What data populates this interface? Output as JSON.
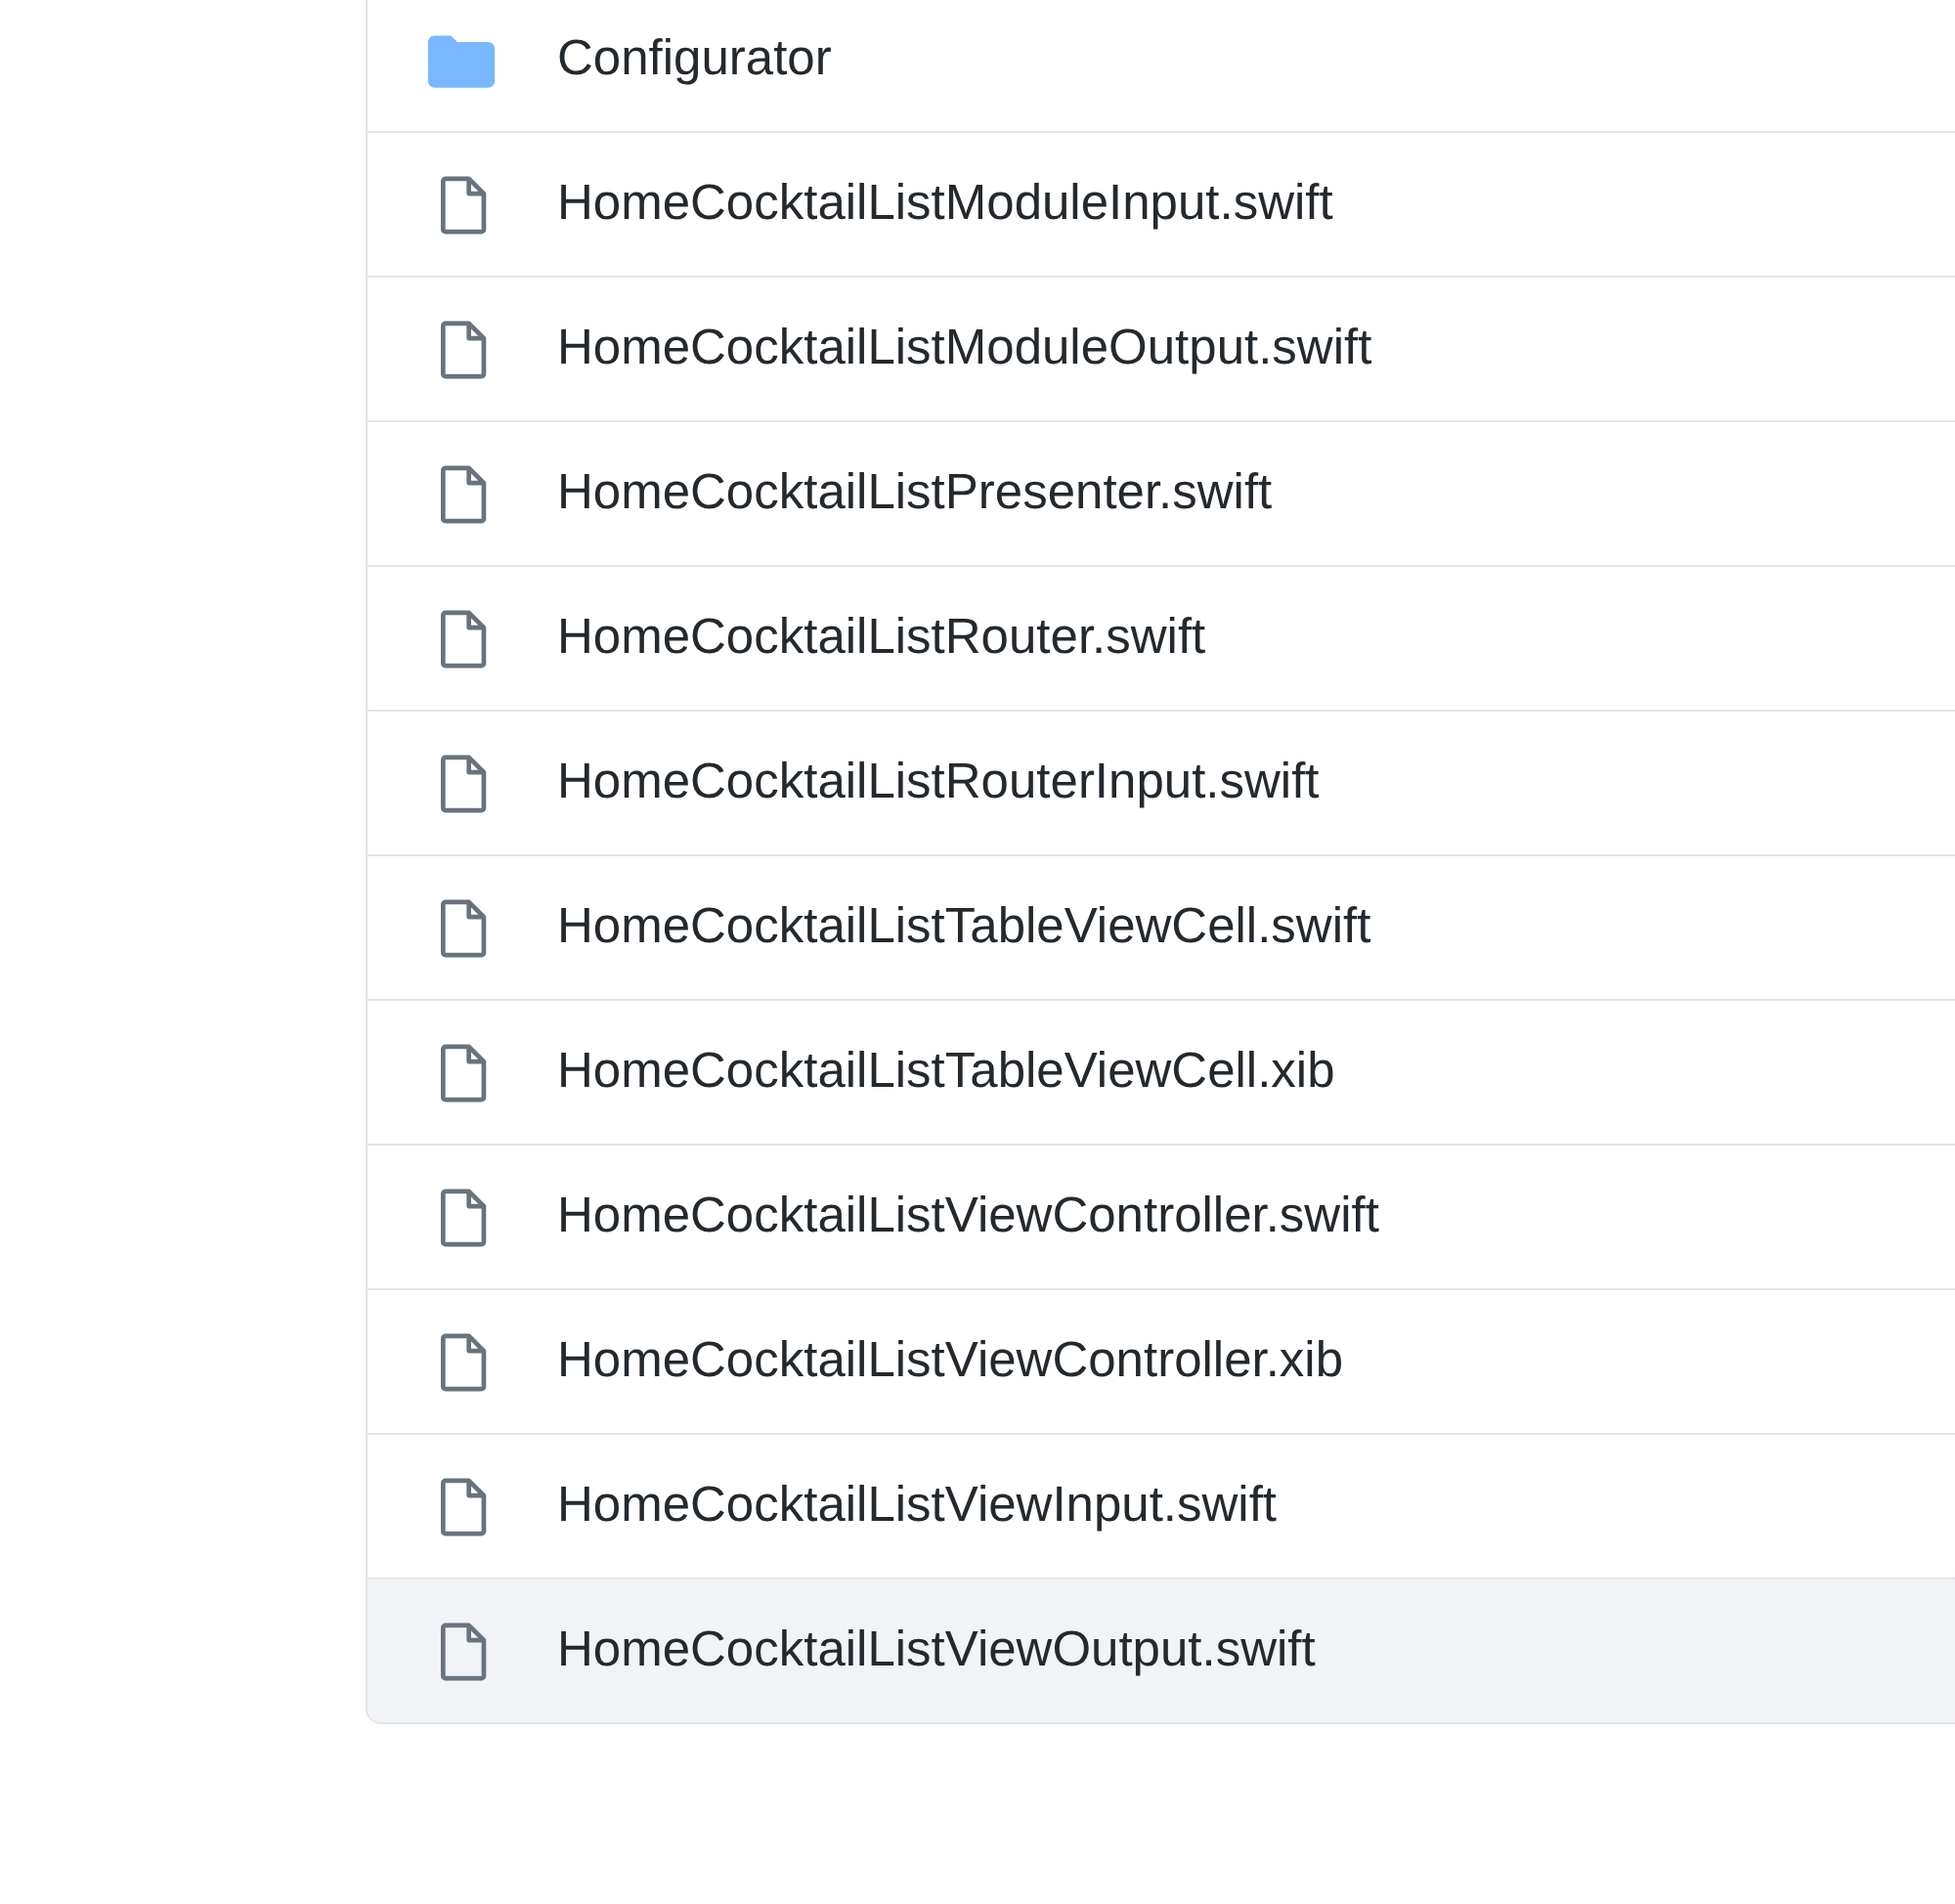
{
  "files": [
    {
      "kind": "folder",
      "name": "Configurator",
      "highlighted": false
    },
    {
      "kind": "file",
      "name": "HomeCocktailListModuleInput.swift",
      "highlighted": false
    },
    {
      "kind": "file",
      "name": "HomeCocktailListModuleOutput.swift",
      "highlighted": false
    },
    {
      "kind": "file",
      "name": "HomeCocktailListPresenter.swift",
      "highlighted": false
    },
    {
      "kind": "file",
      "name": "HomeCocktailListRouter.swift",
      "highlighted": false
    },
    {
      "kind": "file",
      "name": "HomeCocktailListRouterInput.swift",
      "highlighted": false
    },
    {
      "kind": "file",
      "name": "HomeCocktailListTableViewCell.swift",
      "highlighted": false
    },
    {
      "kind": "file",
      "name": "HomeCocktailListTableViewCell.xib",
      "highlighted": false
    },
    {
      "kind": "file",
      "name": "HomeCocktailListViewController.swift",
      "highlighted": false
    },
    {
      "kind": "file",
      "name": "HomeCocktailListViewController.xib",
      "highlighted": false
    },
    {
      "kind": "file",
      "name": "HomeCocktailListViewInput.swift",
      "highlighted": false
    },
    {
      "kind": "file",
      "name": "HomeCocktailListViewOutput.swift",
      "highlighted": true
    }
  ]
}
